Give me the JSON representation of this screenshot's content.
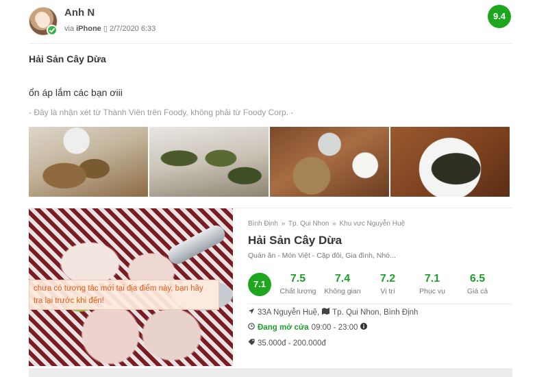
{
  "review": {
    "user_name": "Anh N",
    "via_label": "via",
    "device": "iPhone",
    "date": "2/7/2020 6:33",
    "score": "9.4",
    "title": "Hải Sản Cây Dừa",
    "body": "ổn áp lắm các bạn ơiii",
    "disclaimer": "- Đây là nhận xét từ Thành Viên trên Foody, không phải từ Foody Corp. -",
    "photo_count": 4
  },
  "place": {
    "breadcrumb": [
      "Bình Định",
      "»",
      "Tp. Qui Nhon",
      "»",
      "Khu vực Nguyễn Huệ"
    ],
    "name": "Hải Sản Cây Dừa",
    "category": "Quán ăn - Món Việt - Cặp đôi, Gia đình, Nhó...",
    "notice": "chưa có tương tác mới tại địa điểm này, bạn hãy tra lại trước khi đến!",
    "overall_score": "7.1",
    "metrics": [
      {
        "value": "7.5",
        "label": "Chất lượng"
      },
      {
        "value": "7.4",
        "label": "Không gian"
      },
      {
        "value": "7.2",
        "label": "Vị trí"
      },
      {
        "value": "7.1",
        "label": "Phục vụ"
      },
      {
        "value": "6.5",
        "label": "Giá cả"
      }
    ],
    "address": "33A Nguyễn Huệ,",
    "city": "Tp. Qui Nhon, Bình Định",
    "open_status": "Đang mở cửa",
    "hours": "09:00 - 23:00",
    "price_range": "35.000đ - 200.000đ"
  },
  "colors": {
    "score_green": "#1ea61e",
    "metric_green": "#1e9e2a",
    "notice_orange": "#e25a1b"
  }
}
